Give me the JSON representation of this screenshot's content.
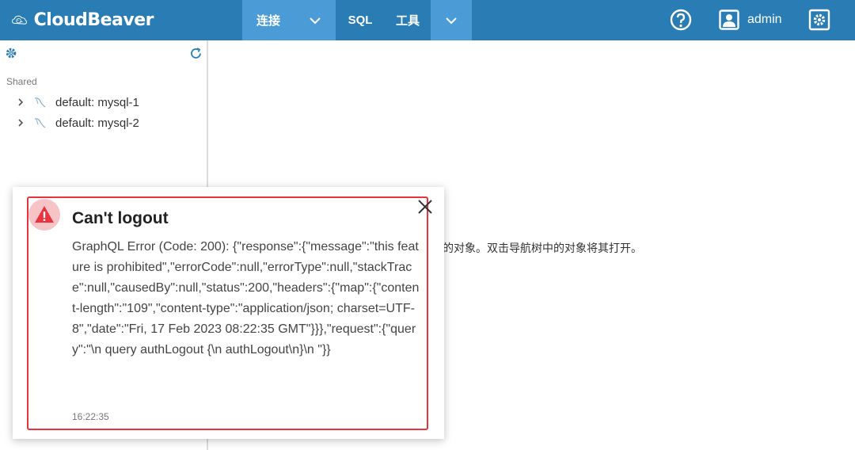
{
  "app": {
    "logo_text": "CloudBeaver"
  },
  "nav": {
    "connect_label": "连接",
    "sql_label": "SQL",
    "tools_label": "工具"
  },
  "user": {
    "name": "admin"
  },
  "sidebar": {
    "section_label": "Shared",
    "items": [
      {
        "label": "default: mysql-1"
      },
      {
        "label": "default: mysql-2"
      }
    ]
  },
  "main": {
    "hint_text": "示的对象。双击导航树中的对象将其打开。"
  },
  "toast": {
    "title": "Can't logout",
    "message": "GraphQL Error (Code: 200): {\"response\":{\"message\":\"this feature is prohibited\",\"errorCode\":null,\"errorType\":null,\"stackTrace\":null,\"causedBy\":null,\"status\":200,\"headers\":{\"map\":{\"content-length\":\"109\",\"content-type\":\"application/json; charset=UTF-8\",\"date\":\"Fri, 17 Feb 2023 08:22:35 GMT\"}}},\"request\":{\"query\":\"\\n query authLogout {\\n authLogout\\n}\\n \"}}",
    "time": "16:22:35"
  },
  "colors": {
    "header": "#2a7cb4",
    "header_active": "#4b9cd6",
    "error": "#e8343f"
  }
}
